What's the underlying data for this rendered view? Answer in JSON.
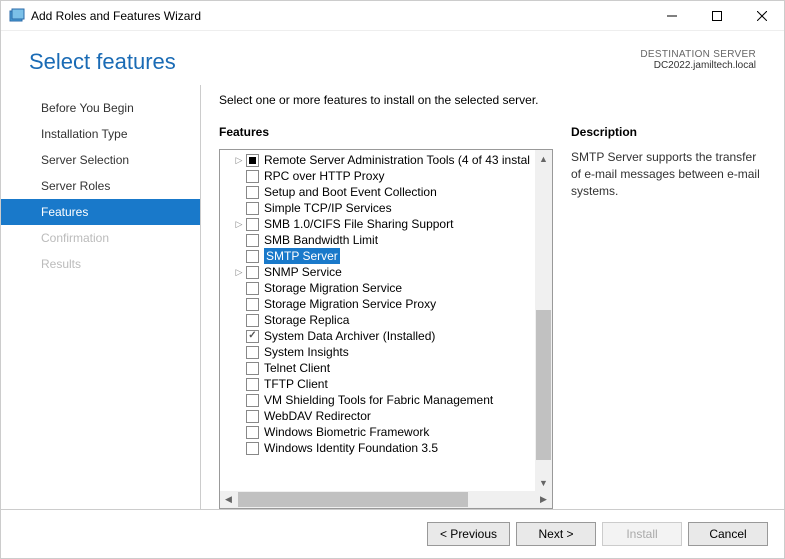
{
  "window": {
    "title": "Add Roles and Features Wizard"
  },
  "header": {
    "title": "Select features",
    "destination_label": "DESTINATION SERVER",
    "destination_value": "DC2022.jamiltech.local"
  },
  "sidebar": {
    "items": [
      {
        "label": "Before You Begin",
        "state": "normal"
      },
      {
        "label": "Installation Type",
        "state": "normal"
      },
      {
        "label": "Server Selection",
        "state": "normal"
      },
      {
        "label": "Server Roles",
        "state": "normal"
      },
      {
        "label": "Features",
        "state": "active"
      },
      {
        "label": "Confirmation",
        "state": "disabled"
      },
      {
        "label": "Results",
        "state": "disabled"
      }
    ]
  },
  "content": {
    "instruction": "Select one or more features to install on the selected server.",
    "features_title": "Features",
    "description_title": "Description",
    "description_text": "SMTP Server supports the transfer of e-mail messages between e-mail systems.",
    "features": [
      {
        "expander": true,
        "check": "filled",
        "label": "Remote Server Administration Tools (4 of 43 instal"
      },
      {
        "expander": false,
        "check": "empty",
        "label": "RPC over HTTP Proxy"
      },
      {
        "expander": false,
        "check": "empty",
        "label": "Setup and Boot Event Collection"
      },
      {
        "expander": false,
        "check": "empty",
        "label": "Simple TCP/IP Services"
      },
      {
        "expander": true,
        "check": "empty",
        "label": "SMB 1.0/CIFS File Sharing Support"
      },
      {
        "expander": false,
        "check": "empty",
        "label": "SMB Bandwidth Limit"
      },
      {
        "expander": false,
        "check": "empty",
        "label": "SMTP Server",
        "selected": true
      },
      {
        "expander": true,
        "check": "empty",
        "label": "SNMP Service"
      },
      {
        "expander": false,
        "check": "empty",
        "label": "Storage Migration Service"
      },
      {
        "expander": false,
        "check": "empty",
        "label": "Storage Migration Service Proxy"
      },
      {
        "expander": false,
        "check": "empty",
        "label": "Storage Replica"
      },
      {
        "expander": false,
        "check": "checked",
        "label": "System Data Archiver (Installed)"
      },
      {
        "expander": false,
        "check": "empty",
        "label": "System Insights"
      },
      {
        "expander": false,
        "check": "empty",
        "label": "Telnet Client"
      },
      {
        "expander": false,
        "check": "empty",
        "label": "TFTP Client"
      },
      {
        "expander": false,
        "check": "empty",
        "label": "VM Shielding Tools for Fabric Management"
      },
      {
        "expander": false,
        "check": "empty",
        "label": "WebDAV Redirector"
      },
      {
        "expander": false,
        "check": "empty",
        "label": "Windows Biometric Framework"
      },
      {
        "expander": false,
        "check": "empty",
        "label": "Windows Identity Foundation 3.5"
      }
    ]
  },
  "footer": {
    "previous": "< Previous",
    "next": "Next >",
    "install": "Install",
    "cancel": "Cancel"
  }
}
